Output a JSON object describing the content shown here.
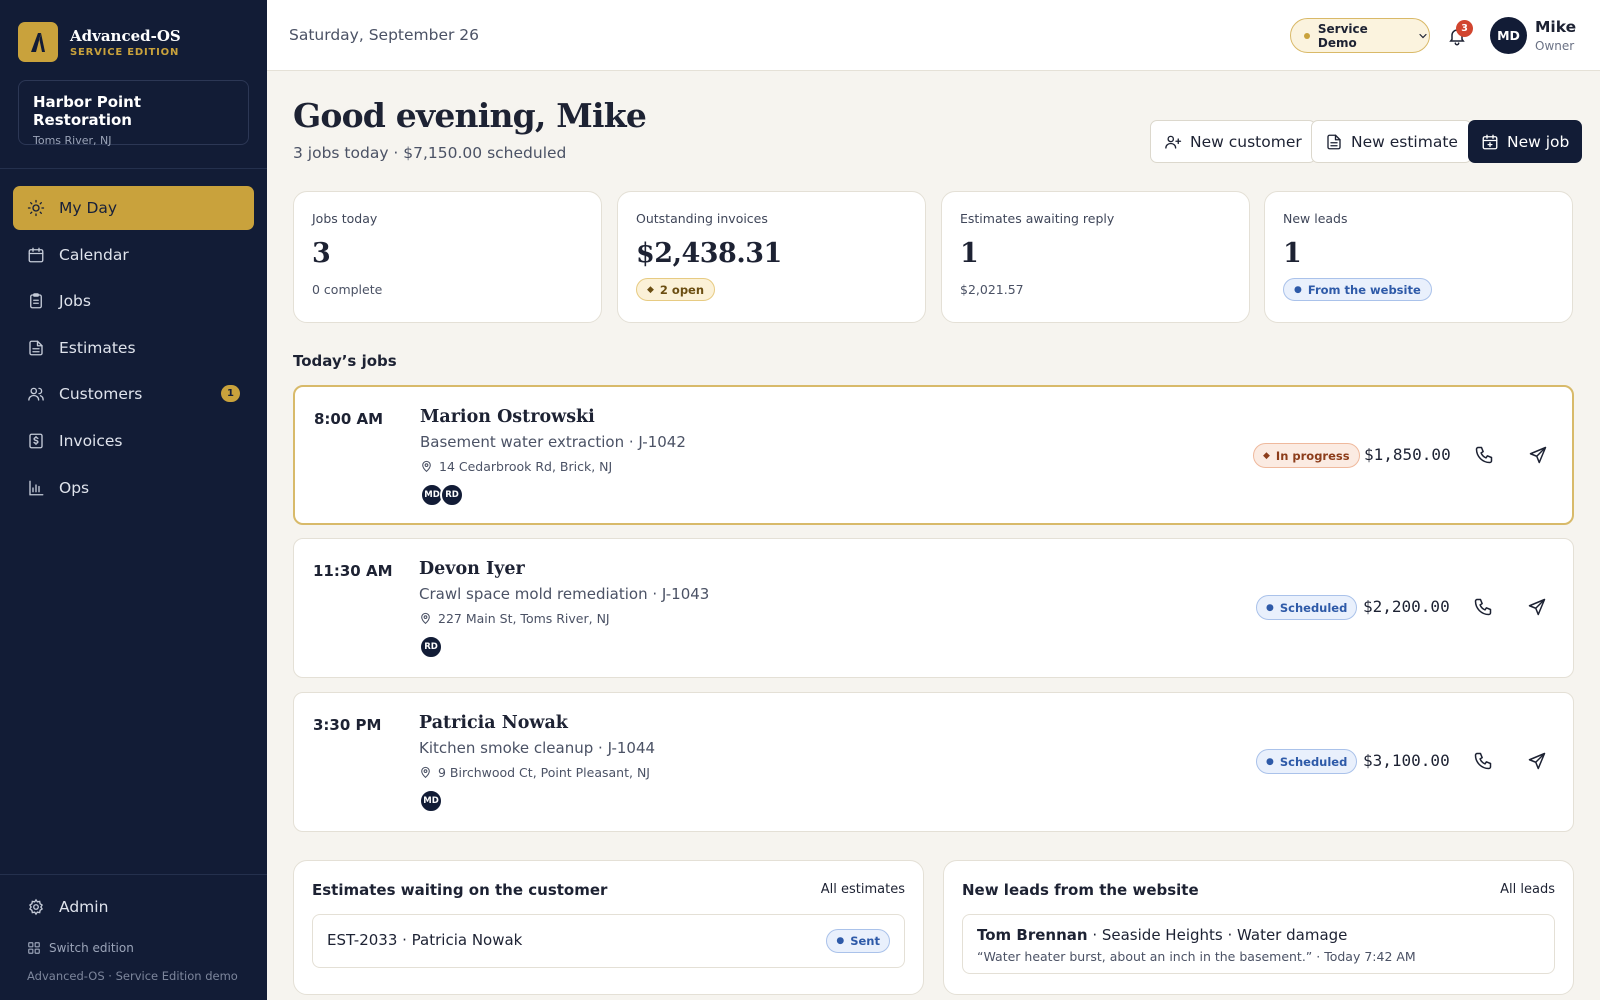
{
  "brand": {
    "name": "Advanced-OS",
    "edition": "SERVICE EDITION"
  },
  "org": {
    "name": "Harbor Point Restoration",
    "location": "Toms River, NJ"
  },
  "nav": [
    {
      "label": "My Day",
      "icon": "sun-icon",
      "active": true
    },
    {
      "label": "Calendar",
      "icon": "calendar-icon"
    },
    {
      "label": "Jobs",
      "icon": "clipboard-icon"
    },
    {
      "label": "Estimates",
      "icon": "document-icon"
    },
    {
      "label": "Customers",
      "icon": "users-icon",
      "badge": "1"
    },
    {
      "label": "Invoices",
      "icon": "invoice-icon"
    },
    {
      "label": "Ops",
      "icon": "bar-chart-icon"
    }
  ],
  "sidebar_footer": {
    "admin": "Admin",
    "switch": "Switch edition",
    "caption": "Advanced-OS · Service Edition demo"
  },
  "topbar": {
    "date": "Saturday, September 26",
    "demo": "Service Demo",
    "notifications": "3",
    "user_initials": "MD",
    "user_name": "Mike",
    "user_role": "Owner"
  },
  "header": {
    "greeting": "Good evening, Mike",
    "subline": "3 jobs today · $7,150.00 scheduled"
  },
  "actions": {
    "new_customer": "New customer",
    "new_estimate": "New estimate",
    "new_job": "New job"
  },
  "stats": {
    "jobs_today": {
      "label": "Jobs today",
      "value": "3",
      "sub": "0 complete"
    },
    "outstanding": {
      "label": "Outstanding invoices",
      "value": "$2,438.31",
      "chip": "2 open"
    },
    "estimates": {
      "label": "Estimates awaiting reply",
      "value": "1",
      "sub": "$2,021.57"
    },
    "leads": {
      "label": "New leads",
      "value": "1",
      "chip": "From the website"
    }
  },
  "todays_jobs_title": "Today’s jobs",
  "jobs": [
    {
      "time": "8:00 AM",
      "customer": "Marion Ostrowski",
      "description": "Basement water extraction · J-1042",
      "address": "14 Cedarbrook Rd, Brick, NJ",
      "crew": [
        "MD",
        "RD"
      ],
      "status": "In progress",
      "amount": "$1,850.00"
    },
    {
      "time": "11:30 AM",
      "customer": "Devon Iyer",
      "description": "Crawl space mold remediation · J-1043",
      "address": "227 Main St, Toms River, NJ",
      "crew": [
        "RD"
      ],
      "status": "Scheduled",
      "amount": "$2,200.00"
    },
    {
      "time": "3:30 PM",
      "customer": "Patricia Nowak",
      "description": "Kitchen smoke cleanup · J-1044",
      "address": "9 Birchwood Ct, Point Pleasant, NJ",
      "crew": [
        "MD"
      ],
      "status": "Scheduled",
      "amount": "$3,100.00"
    }
  ],
  "estimates_panel": {
    "title": "Estimates waiting on the customer",
    "link": "All estimates",
    "rows": [
      {
        "text": "EST-2033 · Patricia Nowak",
        "status": "Sent"
      }
    ]
  },
  "leads_panel": {
    "title": "New leads from the website",
    "link": "All leads",
    "rows": [
      {
        "name": "Tom Brennan",
        "details": " · Seaside Heights · Water damage",
        "quote": "“Water heater burst, about an inch in the basement.” · Today 7:42 AM"
      }
    ]
  },
  "colors": {
    "navy": "#121c36",
    "gold": "#c9a23c",
    "background": "#f6f4ef",
    "alert": "#d1452f",
    "blue": "#2e5aa8"
  }
}
